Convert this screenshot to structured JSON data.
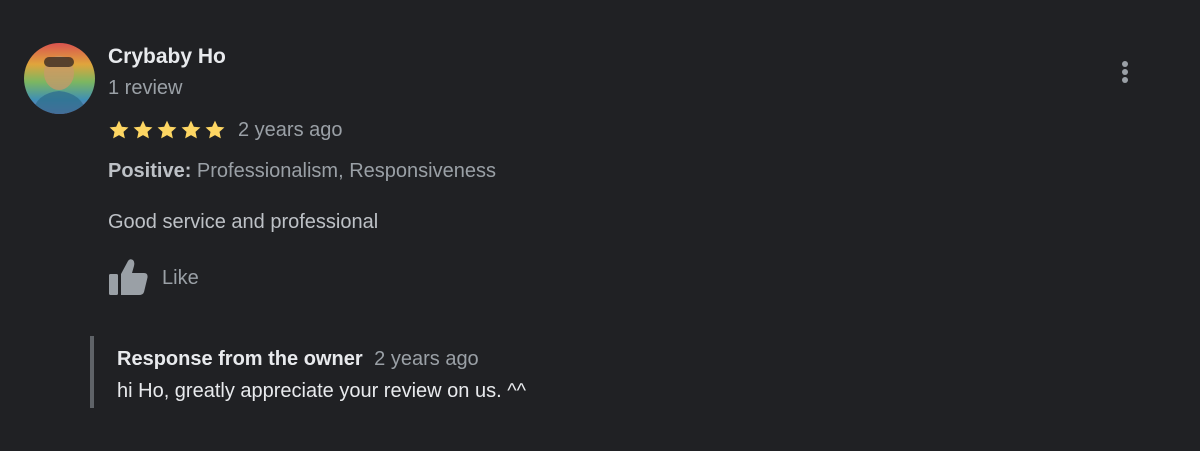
{
  "review": {
    "reviewer_name": "Crybaby Ho",
    "review_count": "1 review",
    "rating": 5,
    "rating_max": 5,
    "star_color": "#fdd663",
    "time": "2 years ago",
    "attributes_label": "Positive:",
    "attributes_value": "Professionalism, Responsiveness",
    "text": "Good service and professional",
    "like_label": "Like",
    "avatar_icon": "profile-photo",
    "more_icon": "more-vert-icon",
    "like_icon": "thumb-up-icon"
  },
  "owner_response": {
    "title": "Response from the owner",
    "time": "2 years ago",
    "text": "hi Ho, greatly appreciate your review on us. ^^"
  },
  "colors": {
    "background": "#202124",
    "primary_text": "#e8eaed",
    "secondary_text": "#9aa0a6",
    "accent_star": "#fdd663"
  }
}
